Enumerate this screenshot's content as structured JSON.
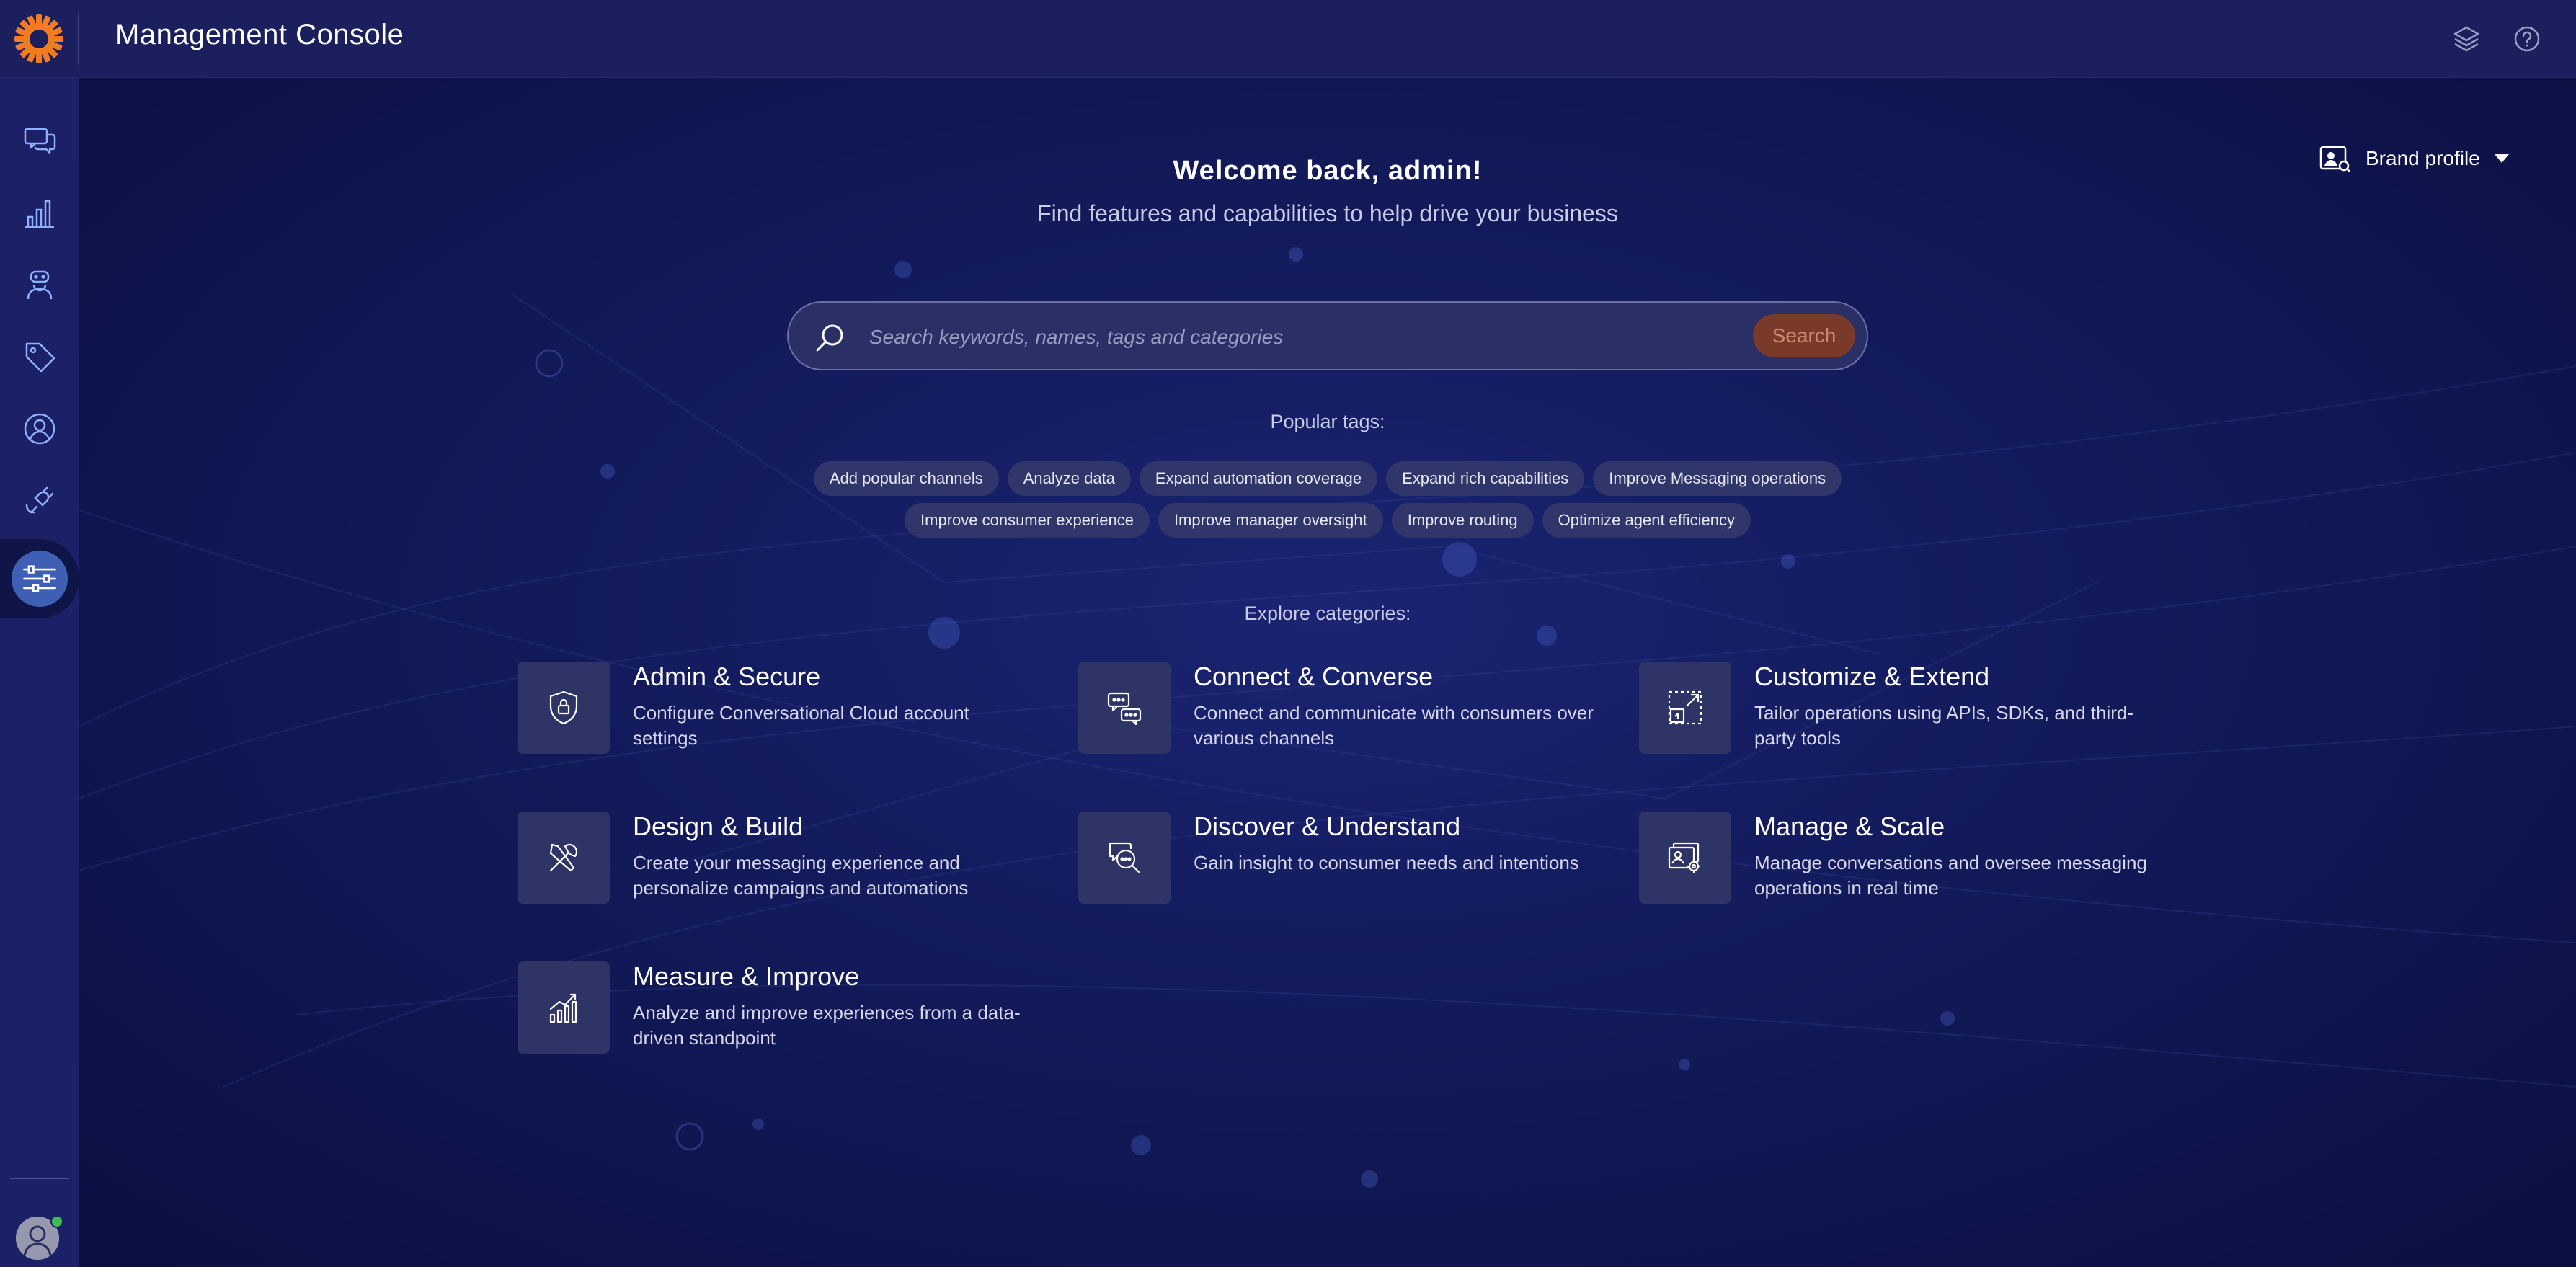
{
  "header": {
    "app_title": "Management Console",
    "layers_icon": "layers-icon",
    "help_icon": "help-icon"
  },
  "sidebar": {
    "items": [
      {
        "icon": "conversations-icon"
      },
      {
        "icon": "analytics-chart-icon"
      },
      {
        "icon": "bot-icon"
      },
      {
        "icon": "tag-icon"
      },
      {
        "icon": "user-profile-icon"
      },
      {
        "icon": "integrations-icon"
      },
      {
        "icon": "settings-sliders-icon",
        "active": true
      }
    ],
    "avatar_status_color": "#3dbb55"
  },
  "brand_profile": {
    "label": "Brand profile"
  },
  "welcome": {
    "title": "Welcome back, admin!",
    "subtitle": "Find features and capabilities to help drive your business"
  },
  "search": {
    "placeholder": "Search keywords, names, tags and categories",
    "value": "",
    "button_label": "Search"
  },
  "popular_tags": {
    "label": "Popular tags:",
    "row1": [
      "Add popular channels",
      "Analyze data",
      "Expand automation coverage",
      "Expand rich capabilities",
      "Improve Messaging operations"
    ],
    "row2": [
      "Improve consumer experience",
      "Improve manager oversight",
      "Improve routing",
      "Optimize agent efficiency"
    ]
  },
  "categories": {
    "label": "Explore categories:",
    "items": [
      {
        "title": "Admin & Secure",
        "desc": "Configure Conversational Cloud account settings",
        "icon": "shield-lock-icon"
      },
      {
        "title": "Connect & Converse",
        "desc": "Connect and communicate with consumers over various channels",
        "icon": "chat-bubbles-icon"
      },
      {
        "title": "Customize & Extend",
        "desc": "Tailor operations using APIs, SDKs, and third-party tools",
        "icon": "extend-icon"
      },
      {
        "title": "Design & Build",
        "desc": "Create your messaging experience and personalize campaigns and automations",
        "icon": "tools-icon"
      },
      {
        "title": "Discover & Understand",
        "desc": "Gain insight to consumer needs and intentions",
        "icon": "search-chat-icon"
      },
      {
        "title": "Manage & Scale",
        "desc": "Manage conversations and oversee messaging operations in real time",
        "icon": "manage-settings-icon"
      },
      {
        "title": "Measure & Improve",
        "desc": "Analyze and improve experiences from a data-driven standpoint",
        "icon": "growth-chart-icon"
      }
    ]
  },
  "colors": {
    "accent": "#f47c20",
    "search_button_bg": "#7a3a2a",
    "sidebar_active": "#3f5fb5"
  }
}
